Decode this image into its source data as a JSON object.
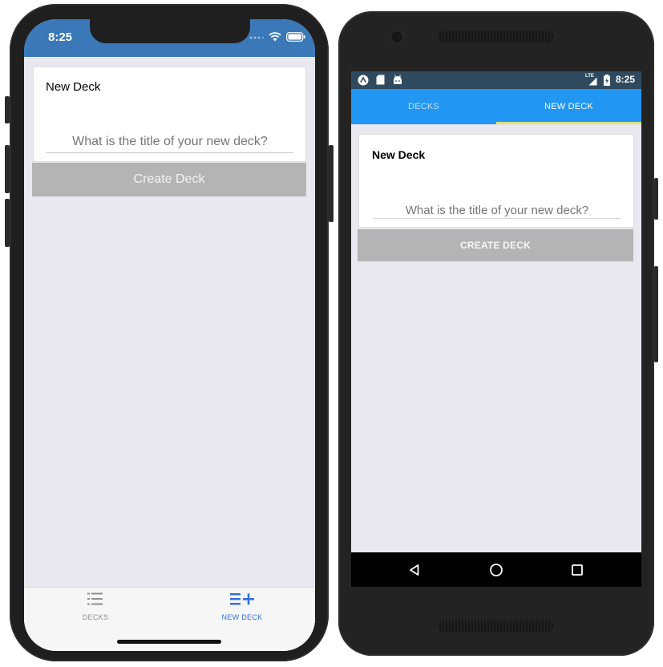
{
  "ios": {
    "status": {
      "time": "8:25"
    },
    "card": {
      "title": "New Deck",
      "placeholder": "What is the title of your new deck?"
    },
    "create_button": "Create Deck",
    "tabs": [
      {
        "label": "DECKS",
        "icon": "list-icon",
        "active": false
      },
      {
        "label": "NEW DECK",
        "icon": "list-add-icon",
        "active": true
      }
    ]
  },
  "android": {
    "status": {
      "time": "8:25",
      "network": "LTE"
    },
    "tabs": [
      {
        "label": "DECKS",
        "active": false
      },
      {
        "label": "NEW DECK",
        "active": true
      }
    ],
    "card": {
      "title": "New Deck",
      "placeholder": "What is the title of your new deck?"
    },
    "create_button": "CREATE DECK",
    "nav": [
      "back-icon",
      "home-icon",
      "recents-icon"
    ]
  },
  "colors": {
    "ios_status_bg": "#3b78b8",
    "ios_tab_active": "#2f6fe0",
    "ios_tab_inactive": "#8e8e93",
    "android_tabs_bg": "#2196f3",
    "android_indicator": "#e2dd84",
    "button_disabled": "#b4b4b4",
    "screen_bg": "#e8e8ee"
  }
}
